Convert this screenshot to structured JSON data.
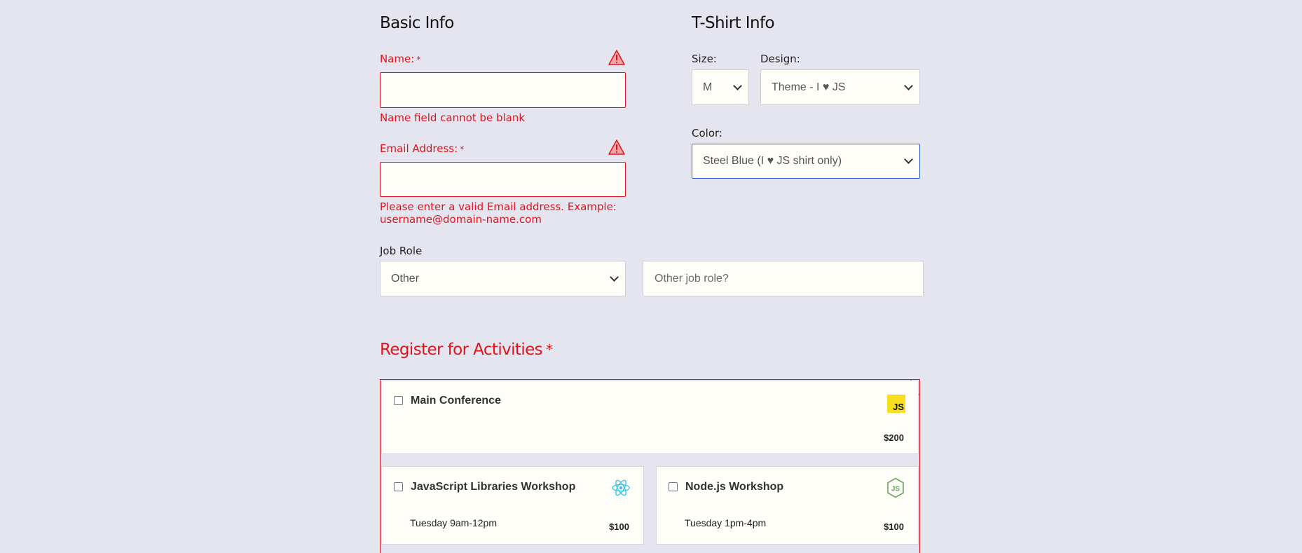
{
  "basic_info": {
    "heading": "Basic Info",
    "name_label": "Name:",
    "name_required": "*",
    "name_value": "",
    "name_error": "Name field cannot be blank",
    "email_label": "Email Address:",
    "email_required": "*",
    "email_value": "",
    "email_error_line1": "Please enter a valid Email address. Example:",
    "email_error_line2": "username@domain-name.com",
    "job_role_label": "Job Role",
    "job_role_selected": "Other",
    "other_job_placeholder": "Other job role?"
  },
  "tshirt_info": {
    "heading": "T-Shirt Info",
    "size_label": "Size:",
    "size_selected": "M",
    "design_label": "Design:",
    "design_selected": "Theme - I ♥ JS",
    "color_label": "Color:",
    "color_selected": "Steel Blue (I ♥ JS shirt only)"
  },
  "activities": {
    "heading": "Register for Activities",
    "required": "*",
    "items": [
      {
        "title": "Main Conference",
        "time": "",
        "cost": "$200",
        "icon": "js-logo-icon",
        "checked": false
      },
      {
        "title": "JavaScript Libraries Workshop",
        "time": "Tuesday 9am-12pm",
        "cost": "$100",
        "icon": "react-logo-icon",
        "checked": false
      },
      {
        "title": "Node.js Workshop",
        "time": "Tuesday 1pm-4pm",
        "cost": "$100",
        "icon": "nodejs-logo-icon",
        "checked": false
      }
    ]
  },
  "colors": {
    "background": "#e5e5ef",
    "error": "#e0141d",
    "focus": "#2f5fd0",
    "field_bg": "#fffdf8",
    "js_yellow": "#f7df1e",
    "react_cyan": "#3fc4e8",
    "node_green": "#6aa361"
  }
}
